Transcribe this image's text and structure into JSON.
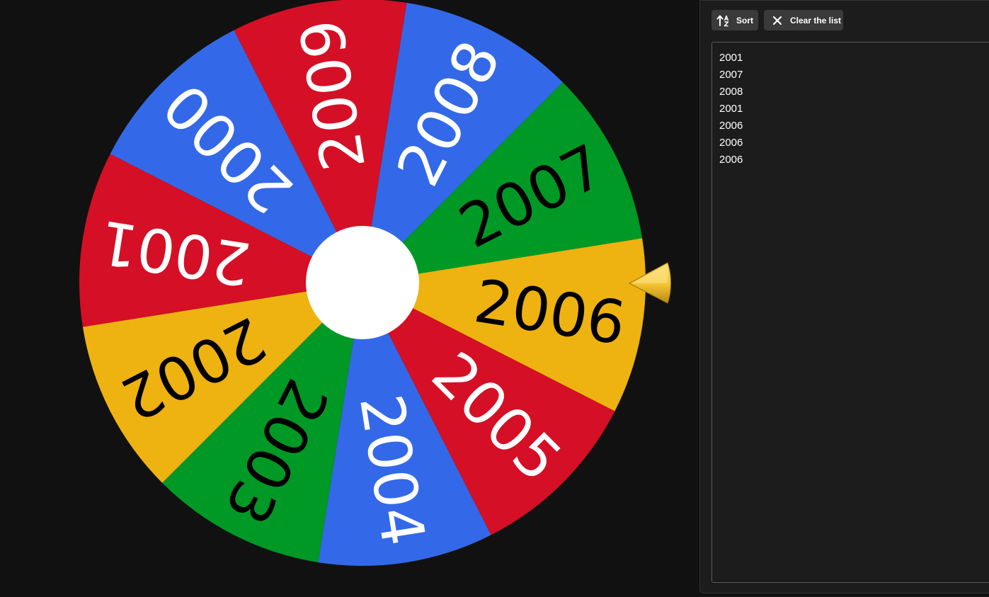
{
  "wheel": {
    "segments": [
      {
        "label": "2000",
        "color": "#3369e8",
        "text_color": "#ffffff"
      },
      {
        "label": "2009",
        "color": "#d50f25",
        "text_color": "#ffffff"
      },
      {
        "label": "2008",
        "color": "#3369e8",
        "text_color": "#ffffff"
      },
      {
        "label": "2007",
        "color": "#009925",
        "text_color": "#000000"
      },
      {
        "label": "2006",
        "color": "#eeb211",
        "text_color": "#000000"
      },
      {
        "label": "2005",
        "color": "#d50f25",
        "text_color": "#ffffff"
      },
      {
        "label": "2004",
        "color": "#3369e8",
        "text_color": "#ffffff"
      },
      {
        "label": "2003",
        "color": "#009925",
        "text_color": "#000000"
      },
      {
        "label": "2002",
        "color": "#eeb211",
        "text_color": "#000000"
      },
      {
        "label": "2001",
        "color": "#d50f25",
        "text_color": "#ffffff"
      }
    ],
    "hub_color": "#ffffff",
    "pointer_icon": "pointer-arrow-icon",
    "pointer_color": "#f2c230"
  },
  "toolbar": {
    "sort_label": "Sort",
    "sort_icon": "sort-icon",
    "clear_label": "Clear the list",
    "clear_icon": "close-icon"
  },
  "entries": [
    "2001",
    "2007",
    "2008",
    "2001",
    "2006",
    "2006",
    "2006"
  ]
}
